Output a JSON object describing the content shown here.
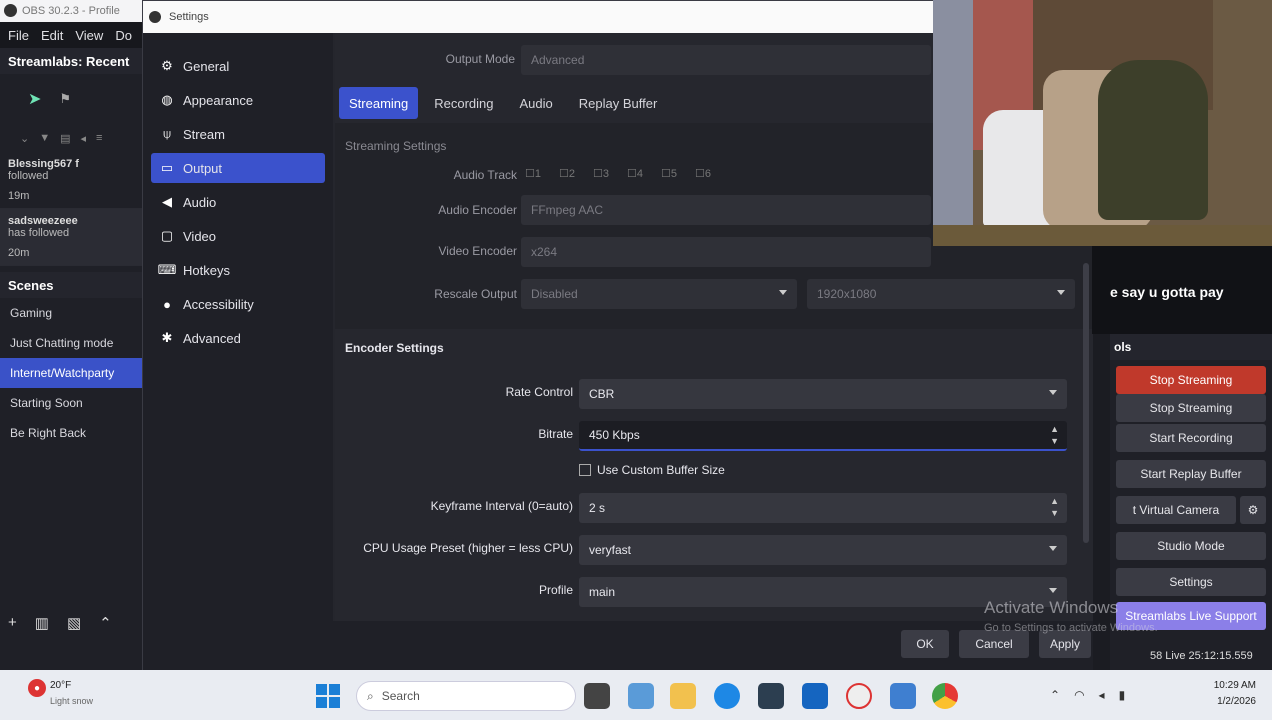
{
  "obs": {
    "title": "OBS 30.2.3 - Profile",
    "menu": [
      "File",
      "Edit",
      "View",
      "Do"
    ],
    "chat_title": "Streamlabs: Recent",
    "chat_items": [
      {
        "user": "Blessing567 f",
        "action": "followed",
        "time": "19m"
      },
      {
        "user": "sadsweezeee",
        "action": "has followed",
        "time": "20m"
      }
    ],
    "scenes_title": "Scenes",
    "scenes": [
      "Gaming",
      "Just Chatting mode",
      "Internet/Watchparty",
      "Starting Soon",
      "Be Right Back"
    ],
    "active_scene": "Internet/Watchparty"
  },
  "settings": {
    "title": "Settings",
    "nav": [
      {
        "label": "General",
        "icon": "gear-icon"
      },
      {
        "label": "Appearance",
        "icon": "palette-icon"
      },
      {
        "label": "Stream",
        "icon": "antenna-icon"
      },
      {
        "label": "Output",
        "icon": "monitor-icon"
      },
      {
        "label": "Audio",
        "icon": "speaker-icon"
      },
      {
        "label": "Video",
        "icon": "video-icon"
      },
      {
        "label": "Hotkeys",
        "icon": "keyboard-icon"
      },
      {
        "label": "Accessibility",
        "icon": "accessibility-icon"
      },
      {
        "label": "Advanced",
        "icon": "wrench-icon"
      }
    ],
    "active_nav": "Output",
    "output_mode_label": "Output Mode",
    "output_mode_value": "Advanced",
    "tabs": [
      "Streaming",
      "Recording",
      "Audio",
      "Replay Buffer"
    ],
    "active_tab": "Streaming",
    "streaming_settings_label": "Streaming Settings",
    "audio_track_label": "Audio Track",
    "audio_tracks": [
      "1",
      "2",
      "3",
      "4",
      "5",
      "6"
    ],
    "audio_encoder_label": "Audio Encoder",
    "audio_encoder_value": "FFmpeg AAC",
    "video_encoder_label": "Video Encoder",
    "video_encoder_value": "x264",
    "rescale_label": "Rescale Output",
    "rescale_value": "Disabled",
    "rescale_res": "1920x1080",
    "encoder_settings_label": "Encoder Settings",
    "rate_control_label": "Rate Control",
    "rate_control_value": "CBR",
    "bitrate_label": "Bitrate",
    "bitrate_value": "450 Kbps",
    "custom_buffer_label": "Use Custom Buffer Size",
    "keyframe_label": "Keyframe Interval (0=auto)",
    "keyframe_value": "2 s",
    "cpu_preset_label": "CPU Usage Preset (higher = less CPU)",
    "cpu_preset_value": "veryfast",
    "profile_label": "Profile",
    "profile_value": "main",
    "ok": "OK",
    "cancel": "Cancel",
    "apply": "Apply"
  },
  "right_dock": {
    "caption": "e say u gotta pay",
    "controls_title": "ols",
    "buttons": [
      "Stop Streaming",
      "Stop Streaming",
      "Start Recording",
      "Start Replay Buffer",
      "t Virtual Camera",
      "Studio Mode",
      "Settings",
      "Streamlabs Live Support"
    ],
    "status": "58 Live 25:12:15.559"
  },
  "watermark": {
    "line1": "Activate Windows",
    "line2": "Go to Settings to activate Windows."
  },
  "taskbar": {
    "weather": "20°F",
    "weather_sub": "Light snow",
    "search_placeholder": "Search",
    "time": "10:29 AM",
    "date": "1/2/2026"
  },
  "colors": {
    "accent": "#3b52cc",
    "stop": "#c0392b",
    "support": "#8b7fe8"
  }
}
